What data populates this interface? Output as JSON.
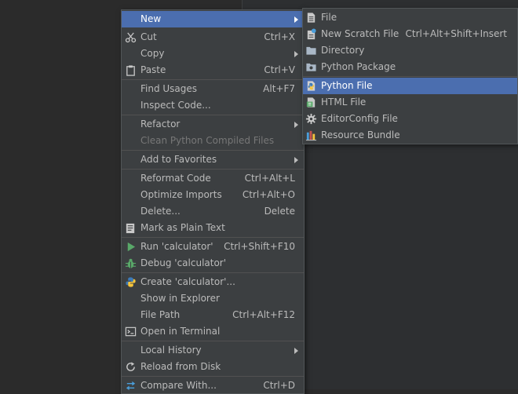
{
  "context_menu": {
    "new_label": "New",
    "cut_label": "Cut",
    "cut_shortcut": "Ctrl+X",
    "copy_label": "Copy",
    "paste_label": "Paste",
    "paste_shortcut": "Ctrl+V",
    "find_usages_label": "Find Usages",
    "find_usages_shortcut": "Alt+F7",
    "inspect_code_label": "Inspect Code...",
    "refactor_label": "Refactor",
    "clean_compiled_label": "Clean Python Compiled Files",
    "add_favorites_label": "Add to Favorites",
    "reformat_label": "Reformat Code",
    "reformat_shortcut": "Ctrl+Alt+L",
    "optimize_label": "Optimize Imports",
    "optimize_shortcut": "Ctrl+Alt+O",
    "delete_label": "Delete...",
    "delete_shortcut": "Delete",
    "plain_text_label": "Mark as Plain Text",
    "run_label": "Run 'calculator'",
    "run_shortcut": "Ctrl+Shift+F10",
    "debug_label": "Debug 'calculator'",
    "create_label": "Create 'calculator'...",
    "show_explorer_label": "Show in Explorer",
    "file_path_label": "File Path",
    "file_path_shortcut": "Ctrl+Alt+F12",
    "open_terminal_label": "Open in Terminal",
    "local_history_label": "Local History",
    "reload_label": "Reload from Disk",
    "compare_label": "Compare With...",
    "compare_shortcut": "Ctrl+D"
  },
  "new_submenu": {
    "file_label": "File",
    "scratch_label": "New Scratch File",
    "scratch_shortcut": "Ctrl+Alt+Shift+Insert",
    "directory_label": "Directory",
    "package_label": "Python Package",
    "python_file_label": "Python File",
    "html_file_label": "HTML File",
    "editorconfig_label": "EditorConfig File",
    "resource_bundle_label": "Resource Bundle"
  },
  "colors": {
    "menu_bg": "#3c3f41",
    "selection_bg": "#4b6eaf",
    "text": "#bbbbbb",
    "disabled_text": "#777777",
    "editor_bg": "#2b2b2b"
  },
  "icons": {
    "cut": "scissors-icon",
    "paste": "clipboard-icon",
    "plain_text": "text-file-icon",
    "run": "run-triangle-icon",
    "debug": "bug-icon",
    "create": "python-logo-icon",
    "terminal": "terminal-icon",
    "reload": "reload-icon",
    "compare": "compare-arrows-icon",
    "file": "file-icon",
    "scratch": "scratch-file-icon",
    "directory": "folder-icon",
    "package": "package-folder-icon",
    "python_file": "python-file-icon",
    "html_file": "html-file-icon",
    "editorconfig": "gear-icon",
    "resource_bundle": "resource-bundle-icon"
  }
}
